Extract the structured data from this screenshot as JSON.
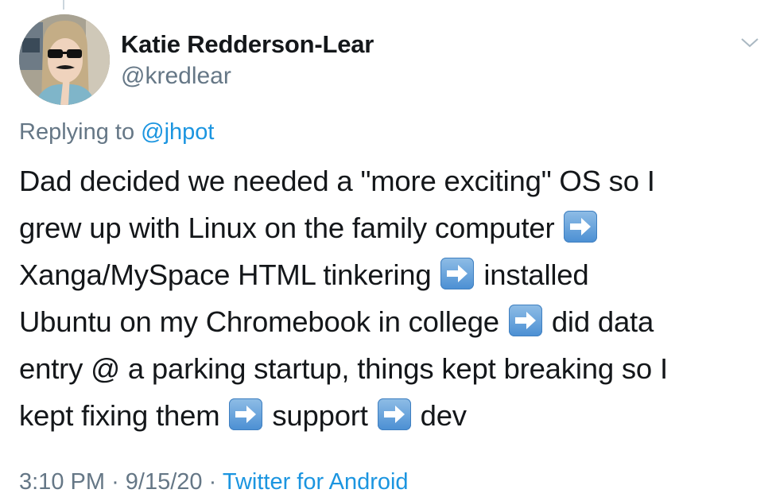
{
  "tweet": {
    "author": {
      "display_name": "Katie Redderson-Lear",
      "handle": "@kredlear"
    },
    "replying_to": {
      "prefix": "Replying to",
      "mention": "@jhpot"
    },
    "body_lines": [
      [
        "Dad decided we needed a \"more exciting\" OS so I"
      ],
      [
        "grew up with Linux on the family computer",
        "arrow-right-emoji"
      ],
      [
        "Xanga/MySpace HTML tinkering",
        "arrow-right-emoji",
        "installed"
      ],
      [
        "Ubuntu on my Chromebook in college",
        "arrow-right-emoji",
        "did data"
      ],
      [
        "entry @ a parking startup, things kept breaking so I"
      ],
      [
        "kept fixing them",
        "arrow-right-emoji",
        "support",
        "arrow-right-emoji",
        "dev"
      ]
    ],
    "meta": {
      "time": "3:10 PM",
      "separator": "·",
      "date": "9/15/20",
      "source": "Twitter for Android"
    }
  },
  "icons": {
    "caret": "chevron-down-icon",
    "emoji": "arrow-right-emoji"
  },
  "colors": {
    "link": "#1b95e0",
    "secondary_text": "#657786",
    "primary_text": "#14171a",
    "emoji_blue": "#4b8fd3"
  }
}
